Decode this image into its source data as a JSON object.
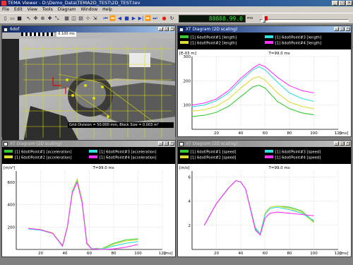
{
  "window": {
    "title": "TEMA Viewer - D:\\Demo_Data\\TEMA2D_TEST\\2D_TEST.tev"
  },
  "menu": [
    "File",
    "Edit",
    "View",
    "Tools",
    "Diagram",
    "Window",
    "Help"
  ],
  "toolbar": {
    "time_readout": "88888.99.0",
    "time_unit": "ms"
  },
  "panels": {
    "video": {
      "title": "6dof",
      "frame_time": "0.100 ms",
      "status": "Grid Division = 50.000 mm, Block Size = 0.003 m²"
    },
    "length": {
      "title": "XT Diagram (2D scaling)"
    },
    "acceleration": {
      "title": "XT Diagram (2D scaling)"
    },
    "speed": {
      "title": "XT Diagram (2D scaling)"
    }
  },
  "colors": {
    "series1": "#33cc33",
    "series2": "#dddd33",
    "series3": "#33dddd",
    "series4": "#ff33ff"
  },
  "chart_data": [
    {
      "type": "line",
      "ylabel": "[E-03 m]",
      "xlabel": "[ms]",
      "annotation": "T=99.0 ms",
      "xlim": [
        0,
        120
      ],
      "ylim": [
        0,
        300
      ],
      "xticks": [
        "20",
        "40",
        "60",
        "80",
        "100",
        "120"
      ],
      "yticks": [
        "100",
        "200",
        "300"
      ],
      "x": [
        0,
        10,
        20,
        30,
        40,
        50,
        55,
        60,
        70,
        80,
        90,
        100
      ],
      "series": [
        {
          "name": "[1] 6dof/Point#1 [length]",
          "color": "#33cc33",
          "values": [
            52,
            58,
            70,
            95,
            135,
            175,
            182,
            170,
            115,
            85,
            68,
            60
          ]
        },
        {
          "name": "[1] 6dof/Point#2 [length]",
          "color": "#dddd33",
          "values": [
            75,
            80,
            95,
            125,
            170,
            210,
            217,
            203,
            150,
            112,
            95,
            85
          ]
        },
        {
          "name": "[1] 6dof/Point#3 [length]",
          "color": "#33dddd",
          "values": [
            93,
            100,
            118,
            150,
            200,
            245,
            258,
            245,
            195,
            150,
            128,
            115
          ]
        },
        {
          "name": "[1] 6dof/Point#4 [length]",
          "color": "#ff33ff",
          "values": [
            100,
            108,
            125,
            160,
            210,
            252,
            268,
            258,
            215,
            180,
            160,
            150
          ]
        }
      ]
    },
    {
      "type": "line",
      "ylabel": "[m/s²]",
      "xlabel": "[ms]",
      "annotation": "T=99.0 ms",
      "xlim": [
        0,
        120
      ],
      "ylim": [
        0,
        700
      ],
      "xticks": [
        "20",
        "40",
        "60",
        "80",
        "100",
        "120"
      ],
      "yticks": [
        "200",
        "400",
        "600"
      ],
      "x": [
        10,
        20,
        30,
        38,
        42,
        46,
        50,
        54,
        58,
        62,
        66,
        70,
        80,
        90,
        100
      ],
      "series": [
        {
          "name": "[1] 6dof/Point#1 [acceleration]",
          "color": "#33cc33",
          "values": [
            185,
            175,
            145,
            30,
            200,
            520,
            620,
            440,
            60,
            5,
            10,
            5,
            55,
            85,
            95
          ]
        },
        {
          "name": "[1] 6dof/Point#2 [acceleration]",
          "color": "#dddd33",
          "values": [
            190,
            178,
            148,
            35,
            205,
            525,
            630,
            445,
            65,
            5,
            8,
            3,
            45,
            75,
            85
          ]
        },
        {
          "name": "[1] 6dof/Point#3 [acceleration]",
          "color": "#33dddd",
          "values": [
            182,
            172,
            142,
            28,
            195,
            515,
            610,
            430,
            55,
            5,
            6,
            2,
            30,
            55,
            70
          ]
        },
        {
          "name": "[1] 6dof/Point#4 [acceleration]",
          "color": "#ff33ff",
          "values": [
            188,
            176,
            144,
            32,
            200,
            505,
            600,
            420,
            50,
            5,
            3,
            0,
            5,
            20,
            45
          ]
        }
      ]
    },
    {
      "type": "line",
      "ylabel": "[m/s]",
      "xlabel": "[ms]",
      "annotation": "T=99.0 ms",
      "xlim": [
        0,
        120
      ],
      "ylim": [
        0,
        6.5
      ],
      "xticks": [
        "20",
        "40",
        "60",
        "80",
        "100",
        "120"
      ],
      "yticks": [
        "2",
        "4",
        "6"
      ],
      "x": [
        10,
        20,
        30,
        36,
        40,
        44,
        48,
        52,
        56,
        60,
        64,
        70,
        80,
        90,
        100
      ],
      "series": [
        {
          "name": "[1] 6dof/Point#1 [speed]",
          "color": "#33cc33",
          "values": [
            2.0,
            3.8,
            5.1,
            5.7,
            5.6,
            5.0,
            3.4,
            1.8,
            1.3,
            3.0,
            3.5,
            3.6,
            3.5,
            3.2,
            2.3
          ]
        },
        {
          "name": "[1] 6dof/Point#2 [speed]",
          "color": "#dddd33",
          "values": [
            2.0,
            3.8,
            5.1,
            5.7,
            5.6,
            5.0,
            3.4,
            1.7,
            1.3,
            3.0,
            3.5,
            3.6,
            3.4,
            3.1,
            2.2
          ]
        },
        {
          "name": "[1] 6dof/Point#3 [speed]",
          "color": "#33dddd",
          "values": [
            2.0,
            3.8,
            5.1,
            5.7,
            5.6,
            5.0,
            3.4,
            1.7,
            1.3,
            2.9,
            3.4,
            3.5,
            3.3,
            3.0,
            2.4
          ]
        },
        {
          "name": "[1] 6dof/Point#4 [speed]",
          "color": "#ff33ff",
          "values": [
            2.0,
            3.8,
            5.1,
            5.7,
            5.6,
            5.0,
            3.3,
            1.6,
            1.2,
            2.6,
            3.0,
            3.1,
            3.0,
            2.9,
            2.8
          ]
        }
      ]
    }
  ]
}
